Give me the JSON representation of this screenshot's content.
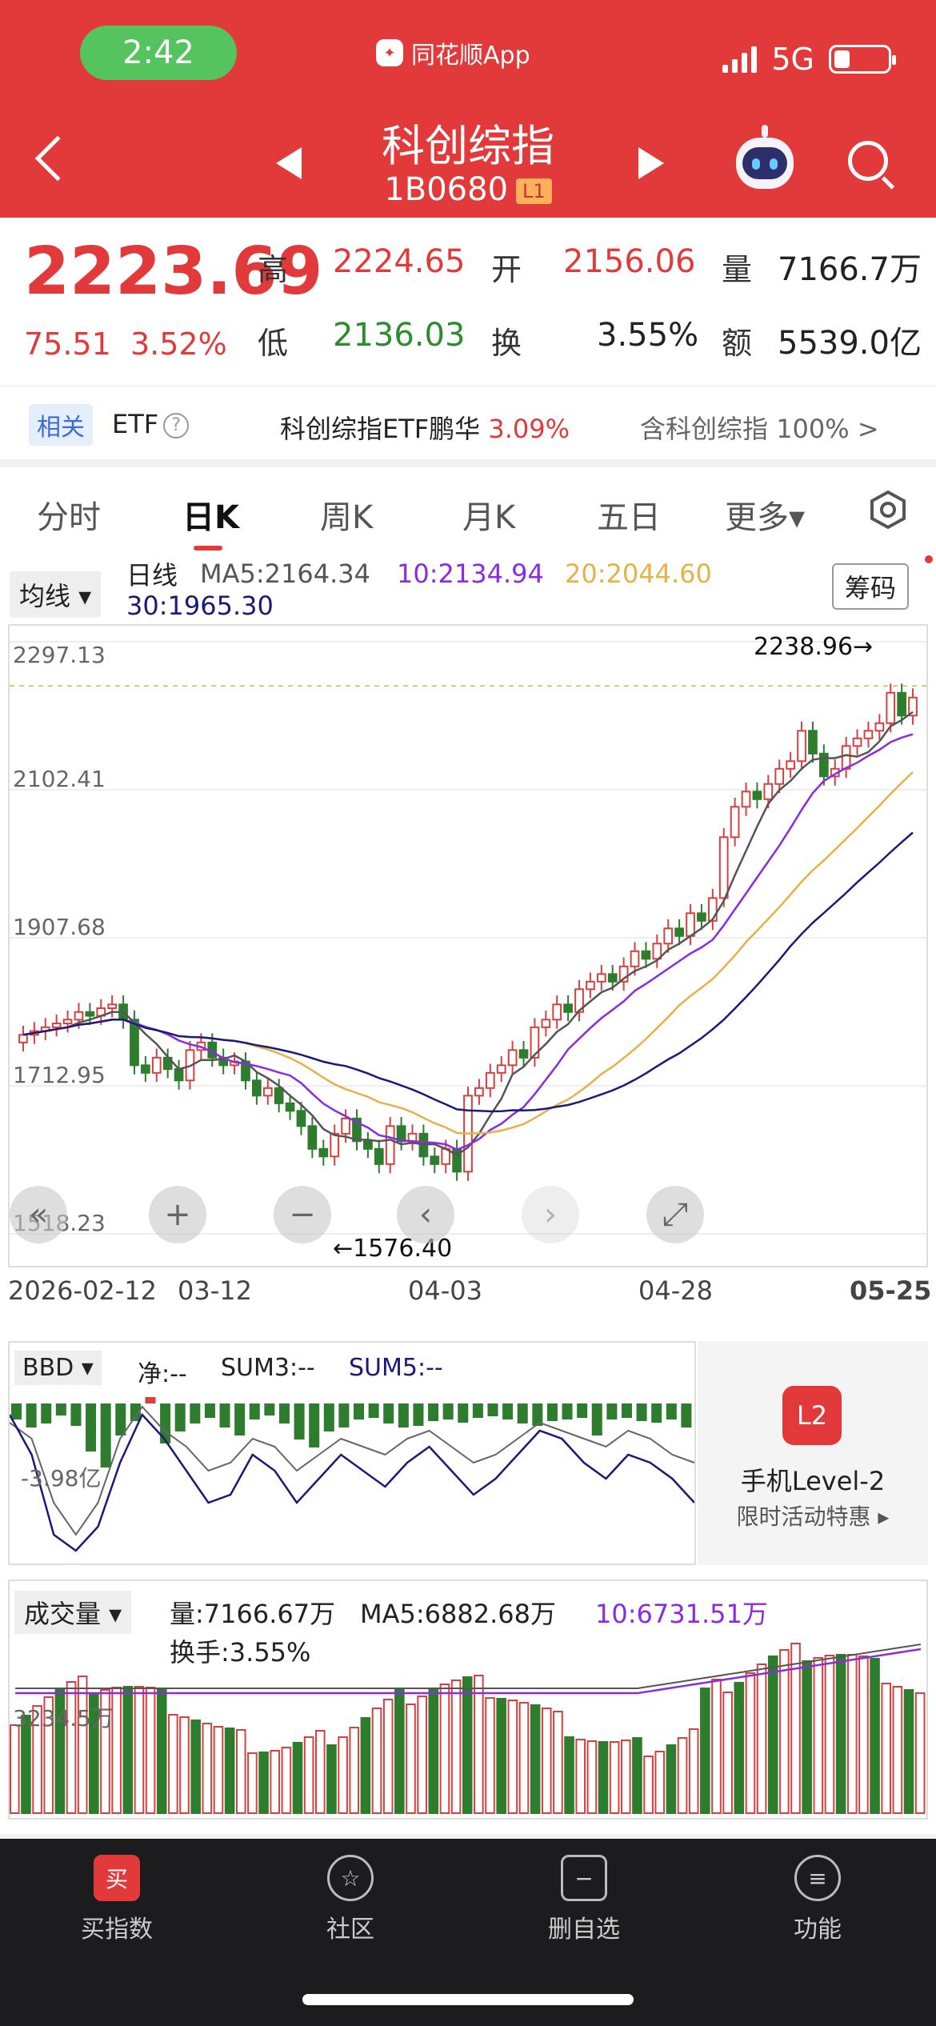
{
  "status": {
    "time": "2:42",
    "app_badge": "同花顺App",
    "network": "5G"
  },
  "header": {
    "title": "科创综指",
    "code": "1B0680",
    "level": "L1"
  },
  "quote": {
    "price": "2223.69",
    "change": "75.51",
    "change_pct": "3.52%",
    "high_label": "高",
    "high": "2224.65",
    "open_label": "开",
    "open": "2156.06",
    "volume_label": "量",
    "volume": "7166.7万",
    "low_label": "低",
    "low": "2136.03",
    "turnover_label": "换",
    "turnover": "3.55%",
    "amount_label": "额",
    "amount": "5539.0亿"
  },
  "etf": {
    "tag": "相关",
    "label": "ETF",
    "info_icon": "?",
    "fund_name": "科创综指ETF鹏华",
    "fund_change": "3.09%",
    "contains_label": "含科创综指",
    "contains_pct": "100%",
    "chevron": ">"
  },
  "tabs": {
    "items": [
      "分时",
      "日K",
      "周K",
      "月K",
      "五日",
      "更多▾"
    ],
    "active_index": 1
  },
  "ma_bar": {
    "selector": "均线 ▾",
    "type": "日线",
    "ma5": "MA5:2164.34",
    "ma10": "10:2134.94",
    "ma20": "20:2044.60",
    "ma30": "30:1965.30",
    "chip_button": "筹码"
  },
  "chart_data": {
    "type": "candlestick",
    "y_ticks": [
      "2297.13",
      "2102.41",
      "1907.68",
      "1712.95",
      "1518.23"
    ],
    "x_ticks": [
      "2026-02-12",
      "03-12",
      "04-03",
      "04-28",
      "05-25"
    ],
    "max_annotation": "2238.96→",
    "min_annotation": "←1576.40",
    "ylim": [
      1518.23,
      2297.13
    ],
    "colors": {
      "up": "#d84040",
      "down": "#2e7d2e",
      "ma5": "#555555",
      "ma10": "#8a2be2",
      "ma20": "#e6b04a",
      "ma30": "#1a1a7a"
    }
  },
  "chart_controls": [
    "«",
    "+",
    "−",
    "‹",
    "›",
    "⤢"
  ],
  "bbd": {
    "selector": "BBD ▾",
    "net": "净:--",
    "sum3": "SUM3:--",
    "sum5": "SUM5:--",
    "axis_label": "-3.98亿",
    "promo_icon": "L2",
    "promo_title": "手机Level-2",
    "promo_sub": "限时活动特惠 ▸"
  },
  "volume": {
    "selector": "成交量 ▾",
    "vol": "量:7166.67万",
    "ma5": "MA5:6882.68万",
    "ma10": "10:6731.51万",
    "turnover": "换手:3.55%",
    "axis_label": "3234.5万"
  },
  "nav": {
    "items": [
      {
        "label": "买指数",
        "icon": "买"
      },
      {
        "label": "社区",
        "icon": "☆"
      },
      {
        "label": "删自选",
        "icon": "−"
      },
      {
        "label": "功能",
        "icon": "≡"
      }
    ]
  }
}
